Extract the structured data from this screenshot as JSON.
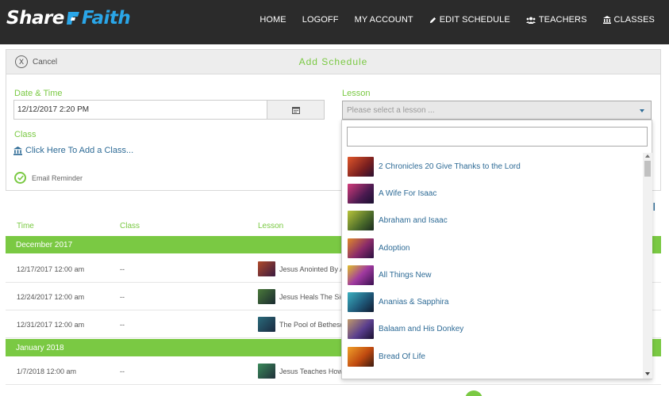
{
  "brand": {
    "part1": "Share",
    "part2": "Faith"
  },
  "nav": [
    {
      "label": "HOME",
      "icon": ""
    },
    {
      "label": "LOGOFF",
      "icon": ""
    },
    {
      "label": "MY ACCOUNT",
      "icon": ""
    },
    {
      "label": "EDIT SCHEDULE",
      "icon": "pencil-icon"
    },
    {
      "label": "TEACHERS",
      "icon": "users-icon"
    },
    {
      "label": "CLASSES",
      "icon": "bank-icon"
    }
  ],
  "panel": {
    "cancel_label": "Cancel",
    "cancel_icon_text": "X",
    "title": "Add Schedule",
    "datetime_label": "Date & Time",
    "datetime_value": "12/12/2017 2:20 PM",
    "class_label": "Class",
    "add_class_label": "Click Here To Add a Class...",
    "email_reminder_label": "Email Reminder",
    "lesson_label": "Lesson",
    "lesson_placeholder": "Please select a lesson ..."
  },
  "table": {
    "headers": {
      "time": "Time",
      "class": "Class",
      "lesson": "Lesson"
    },
    "groups": [
      {
        "month": "December 2017",
        "rows": [
          {
            "time": "12/17/2017 12:00 am",
            "class": "--",
            "lesson": "Jesus Anointed By A"
          },
          {
            "time": "12/24/2017 12:00 am",
            "class": "--",
            "lesson": "Jesus Heals The Sick"
          },
          {
            "time": "12/31/2017 12:00 am",
            "class": "--",
            "lesson": "The Pool of Bethesd"
          }
        ]
      },
      {
        "month": "January 2018",
        "rows": [
          {
            "time": "1/7/2018 12:00 am",
            "class": "--",
            "lesson": "Jesus Teaches How"
          }
        ]
      }
    ]
  },
  "dropdown": {
    "search_value": "",
    "items": [
      {
        "label": "2 Chronicles 20 Give Thanks to the Lord",
        "color": "#c0392b"
      },
      {
        "label": "A Wife For Isaac",
        "color": "#a8326b"
      },
      {
        "label": "Abraham and Isaac",
        "color": "#6b8e23"
      },
      {
        "label": "Adoption",
        "color": "#8e44ad"
      },
      {
        "label": "All Things New",
        "color": "#9b30a0"
      },
      {
        "label": "Ananias & Sapphira",
        "color": "#1f6f8b"
      },
      {
        "label": "Balaam and His Donkey",
        "color": "#5a3e8e"
      },
      {
        "label": "Bread Of Life",
        "color": "#d35400"
      }
    ]
  },
  "colors": {
    "accent": "#7ac943",
    "link": "#2e6b96",
    "topbar": "#2b2b2b",
    "brand_blue": "#2aa6e8"
  }
}
